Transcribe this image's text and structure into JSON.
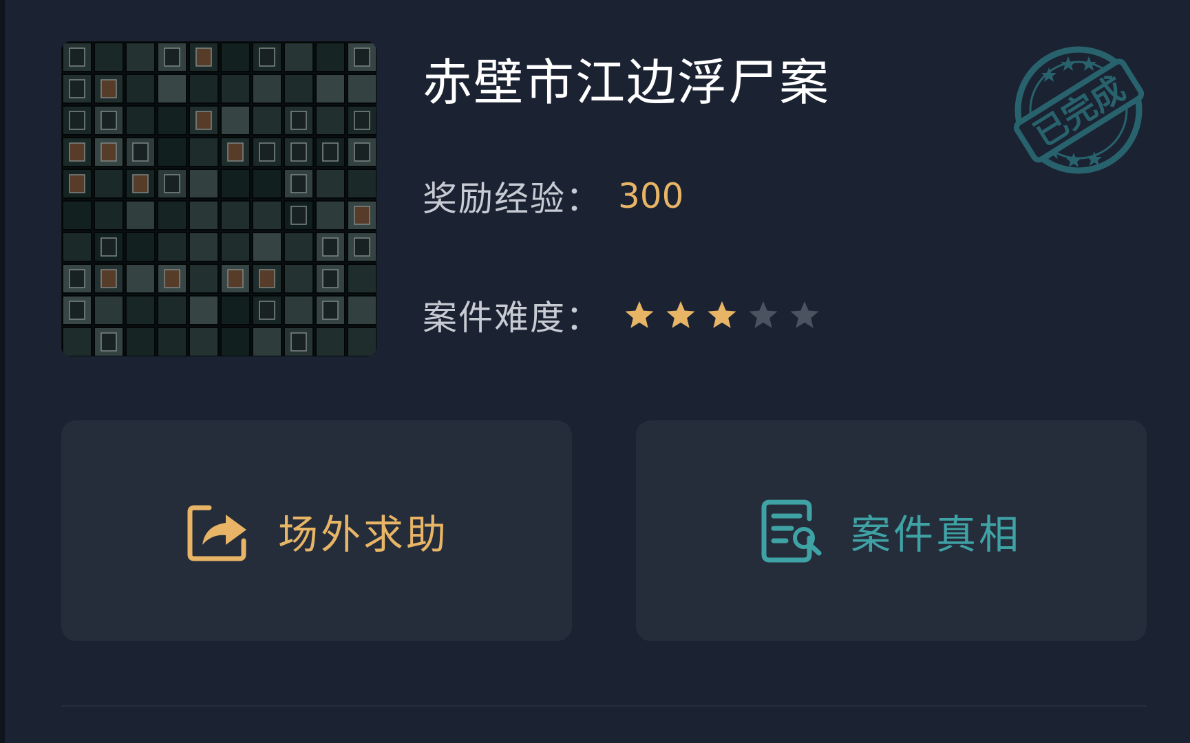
{
  "case": {
    "title": "赤壁市江边浮尸案",
    "status_stamp": "已完成",
    "cover_image": "dark-cube-grid-artwork"
  },
  "reward": {
    "label": "奖励经验：",
    "value": "300"
  },
  "difficulty": {
    "label": "案件难度：",
    "rating": 3,
    "max_rating": 5
  },
  "actions": {
    "help": {
      "label": "场外求助",
      "icon": "share-arrow-icon"
    },
    "truth": {
      "label": "案件真相",
      "icon": "document-search-icon"
    }
  },
  "colors": {
    "background": "#1b2232",
    "card": "#252d3b",
    "accent_gold": "#e8b566",
    "accent_teal": "#3fa3a6",
    "star_off": "#4b5361",
    "stamp": "#2b6f78"
  }
}
